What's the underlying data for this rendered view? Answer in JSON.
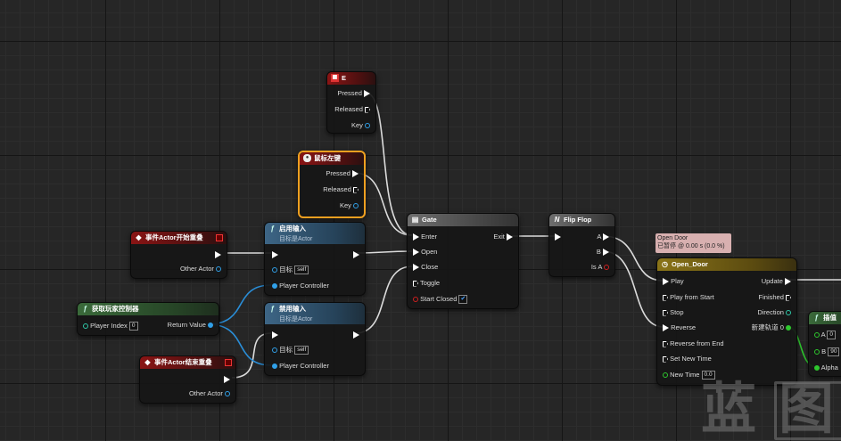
{
  "nodes": {
    "key_e": {
      "title": "E",
      "pressed": "Pressed",
      "released": "Released",
      "key": "Key"
    },
    "mouse_left": {
      "title": "鼠标左键",
      "pressed": "Pressed",
      "released": "Released",
      "key": "Key"
    },
    "begin_overlap": {
      "title": "事件Actor开始重叠",
      "other": "Other Actor"
    },
    "end_overlap": {
      "title": "事件Actor结束重叠",
      "other": "Other Actor"
    },
    "get_pc": {
      "title": "获取玩家控制器",
      "player_index": "Player Index",
      "player_index_value": "0",
      "return": "Return Value"
    },
    "enable_input": {
      "title": "启用输入",
      "subtitle": "目标是Actor",
      "target": "目标",
      "target_value": "self",
      "pc": "Player Controller"
    },
    "disable_input": {
      "title": "禁用输入",
      "subtitle": "目标是Actor",
      "target": "目标",
      "target_value": "self",
      "pc": "Player Controller"
    },
    "gate": {
      "title": "Gate",
      "enter": "Enter",
      "exit": "Exit",
      "open": "Open",
      "close": "Close",
      "toggle": "Toggle",
      "start_closed": "Start Closed",
      "start_closed_check": "✔"
    },
    "flipflop": {
      "title": "Flip Flop",
      "a": "A",
      "b": "B",
      "is_a": "Is A"
    },
    "timeline": {
      "title": "Open_Door",
      "play": "Play",
      "play_start": "Play from Start",
      "stop": "Stop",
      "reverse": "Reverse",
      "reverse_end": "Reverse from End",
      "set_time": "Set New Time",
      "new_time": "New Time",
      "new_time_value": "0.0",
      "update": "Update",
      "finished": "Finished",
      "direction": "Direction",
      "track": "新建轨道 0"
    },
    "lerp": {
      "title": "插值",
      "a": "A",
      "a_value": "0",
      "b": "B",
      "b_value": "90",
      "alpha": "Alpha"
    }
  },
  "bubble": {
    "line1": "Open Door",
    "line2": "已暂停 @ 0.00 s (0.0 %)"
  },
  "watermark": {
    "c1": "蓝",
    "c2": "图"
  },
  "colors": {
    "exec": "#ffffff",
    "object": "#30a0e8",
    "float": "#2ec82e",
    "bool": "#d02020",
    "event_header": "#8a1414",
    "function_header": "#3d6585",
    "timeline_header": "#8a7418",
    "selection": "#f0a020"
  }
}
